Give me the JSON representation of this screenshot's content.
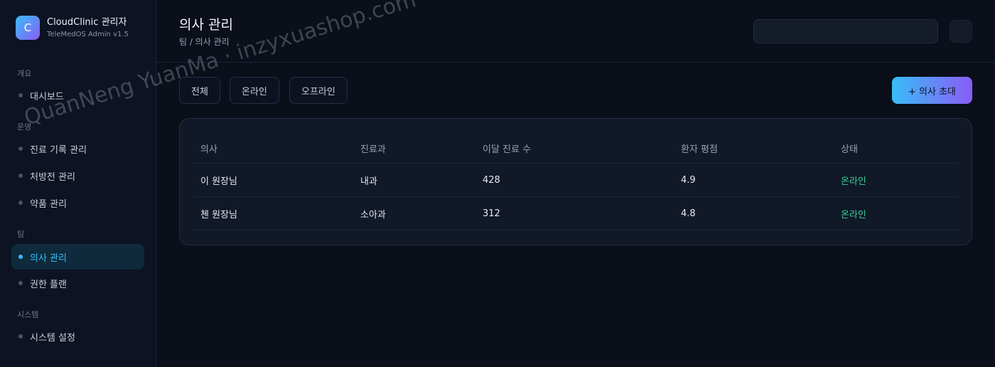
{
  "brand": {
    "logo_letter": "C",
    "title": "CloudClinic 관리자",
    "subtitle": "TeleMedOS Admin v1.5"
  },
  "sidebar": {
    "sections": [
      {
        "label": "개요",
        "items": [
          {
            "label": "대시보드",
            "active": false
          }
        ]
      },
      {
        "label": "운영",
        "items": [
          {
            "label": "진료 기록 관리",
            "active": false
          },
          {
            "label": "처방전 관리",
            "active": false
          },
          {
            "label": "약품 관리",
            "active": false
          }
        ]
      },
      {
        "label": "팀",
        "items": [
          {
            "label": "의사 관리",
            "active": true
          },
          {
            "label": "권한 플랜",
            "active": false
          }
        ]
      },
      {
        "label": "시스템",
        "items": [
          {
            "label": "시스템 설정",
            "active": false
          }
        ]
      }
    ]
  },
  "header": {
    "title": "의사 관리",
    "breadcrumb": "팀 / 의사 관리",
    "search_value": ""
  },
  "filters": [
    {
      "label": "전체"
    },
    {
      "label": "온라인"
    },
    {
      "label": "오프라인"
    }
  ],
  "invite_button": "+ 의사 초대",
  "table": {
    "columns": [
      "의사",
      "진료과",
      "이달 진료 수",
      "환자 평점",
      "상태"
    ],
    "rows": [
      [
        "이 원장님",
        "내과",
        "428",
        "4.9",
        "온라인"
      ],
      [
        "첸 원장님",
        "소아과",
        "312",
        "4.8",
        "온라인"
      ]
    ]
  },
  "watermark": "QuanNeng YuanMa · inzyxuashop.com",
  "colors": {
    "accent": "#38bdf8",
    "accent_end": "#8b5cf6",
    "online": "#34d399",
    "background": "#0a0f1a"
  }
}
